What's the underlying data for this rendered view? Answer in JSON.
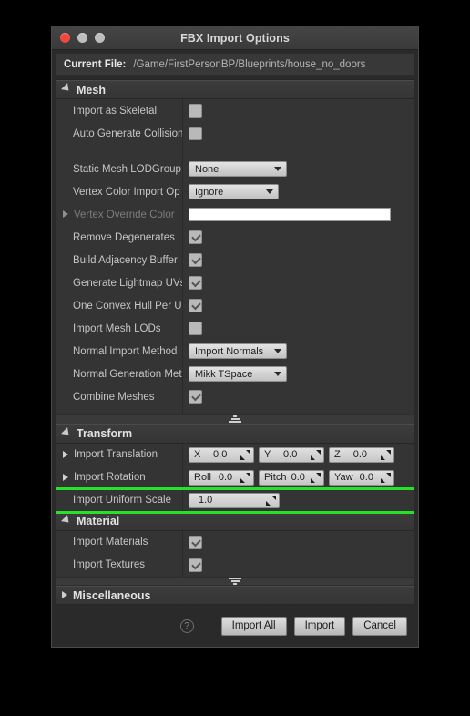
{
  "window": {
    "title": "FBX Import Options",
    "traffic_lights": [
      "close",
      "minimize",
      "zoom"
    ]
  },
  "file_bar": {
    "label": "Current File:",
    "path": "/Game/FirstPersonBP/Blueprints/house_no_doors"
  },
  "sections": {
    "mesh": {
      "title": "Mesh",
      "expanded": true,
      "rows": [
        {
          "label": "Import as Skeletal",
          "type": "checkbox",
          "checked": false
        },
        {
          "label": "Auto Generate Collision",
          "type": "checkbox",
          "checked": false
        },
        {
          "label": "Static Mesh LODGroup",
          "type": "dropdown",
          "value": "None"
        },
        {
          "label": "Vertex Color Import Op",
          "type": "dropdown",
          "value": "Ignore"
        },
        {
          "label": "Vertex Override Color",
          "type": "color",
          "value": "#ffffff",
          "disabled": true
        },
        {
          "label": "Remove Degenerates",
          "type": "checkbox",
          "checked": true
        },
        {
          "label": "Build Adjacency Buffer",
          "type": "checkbox",
          "checked": true
        },
        {
          "label": "Generate Lightmap UVs",
          "type": "checkbox",
          "checked": true
        },
        {
          "label": "One Convex Hull Per UC",
          "type": "checkbox",
          "checked": true
        },
        {
          "label": "Import Mesh LODs",
          "type": "checkbox",
          "checked": false
        },
        {
          "label": "Normal Import Method",
          "type": "dropdown",
          "value": "Import Normals"
        },
        {
          "label": "Normal Generation Met",
          "type": "dropdown",
          "value": "Mikk TSpace"
        },
        {
          "label": "Combine Meshes",
          "type": "checkbox",
          "checked": true
        }
      ]
    },
    "transform": {
      "title": "Transform",
      "expanded": true,
      "translation": {
        "label": "Import Translation",
        "fields": [
          {
            "axis": "X",
            "value": "0.0"
          },
          {
            "axis": "Y",
            "value": "0.0"
          },
          {
            "axis": "Z",
            "value": "0.0"
          }
        ]
      },
      "rotation": {
        "label": "Import Rotation",
        "fields": [
          {
            "axis": "Roll",
            "value": "0.0"
          },
          {
            "axis": "Pitch",
            "value": "0.0"
          },
          {
            "axis": "Yaw",
            "value": "0.0"
          }
        ]
      },
      "uniform_scale": {
        "label": "Import Uniform Scale",
        "value": "1.0",
        "highlighted": true,
        "highlight_color": "#27e327"
      }
    },
    "material": {
      "title": "Material",
      "expanded": true,
      "rows": [
        {
          "label": "Import Materials",
          "type": "checkbox",
          "checked": true
        },
        {
          "label": "Import Textures",
          "type": "checkbox",
          "checked": true
        }
      ]
    },
    "miscellaneous": {
      "title": "Miscellaneous",
      "expanded": false
    }
  },
  "footer": {
    "help_glyph": "?",
    "buttons": [
      {
        "label": "Import All"
      },
      {
        "label": "Import"
      },
      {
        "label": "Cancel"
      }
    ]
  }
}
